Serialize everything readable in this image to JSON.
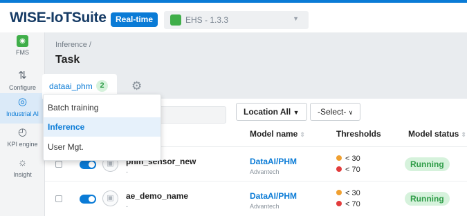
{
  "header": {
    "logo": "WISE-IoTSuite",
    "realtime_badge": "Real-time",
    "app_select": "EHS - 1.3.3"
  },
  "sidebar": {
    "items": [
      {
        "label": "FMS",
        "icon": "fms-icon"
      },
      {
        "label": "Configure",
        "icon": "configure-icon"
      },
      {
        "label": "Industrial AI",
        "icon": "industrial-ai-icon",
        "active": true
      },
      {
        "label": "KPI engine",
        "icon": "gauge-icon"
      },
      {
        "label": "Insight",
        "icon": "bulb-icon"
      }
    ]
  },
  "breadcrumb": "Inference /",
  "page_title": "Task",
  "tab": {
    "label": "dataai_phm",
    "count": "2"
  },
  "dropdown": {
    "items": [
      {
        "label": "Batch training"
      },
      {
        "label": "Inference",
        "active": true
      },
      {
        "label": "User Mgt."
      }
    ]
  },
  "filters": {
    "search_placeholder": "",
    "location": "Location All",
    "select": "-Select-"
  },
  "columns": {
    "model_name": "Model name",
    "thresholds": "Thresholds",
    "model_status": "Model status"
  },
  "rows": [
    {
      "task": "phm_sensor_new",
      "sub": "-",
      "model": "DataAI/PHM",
      "vendor": "Advantech",
      "th_low": "< 30",
      "th_high": "< 70",
      "status": "Running"
    },
    {
      "task": "ae_demo_name",
      "sub": "-",
      "model": "DataAI/PHM",
      "vendor": "Advantech",
      "th_low": "< 30",
      "th_high": "< 70",
      "status": "Running"
    }
  ],
  "colors": {
    "accent": "#0a7bd6",
    "warn": "#f0a030",
    "danger": "#e23c3c",
    "ok": "#2e9c47"
  }
}
